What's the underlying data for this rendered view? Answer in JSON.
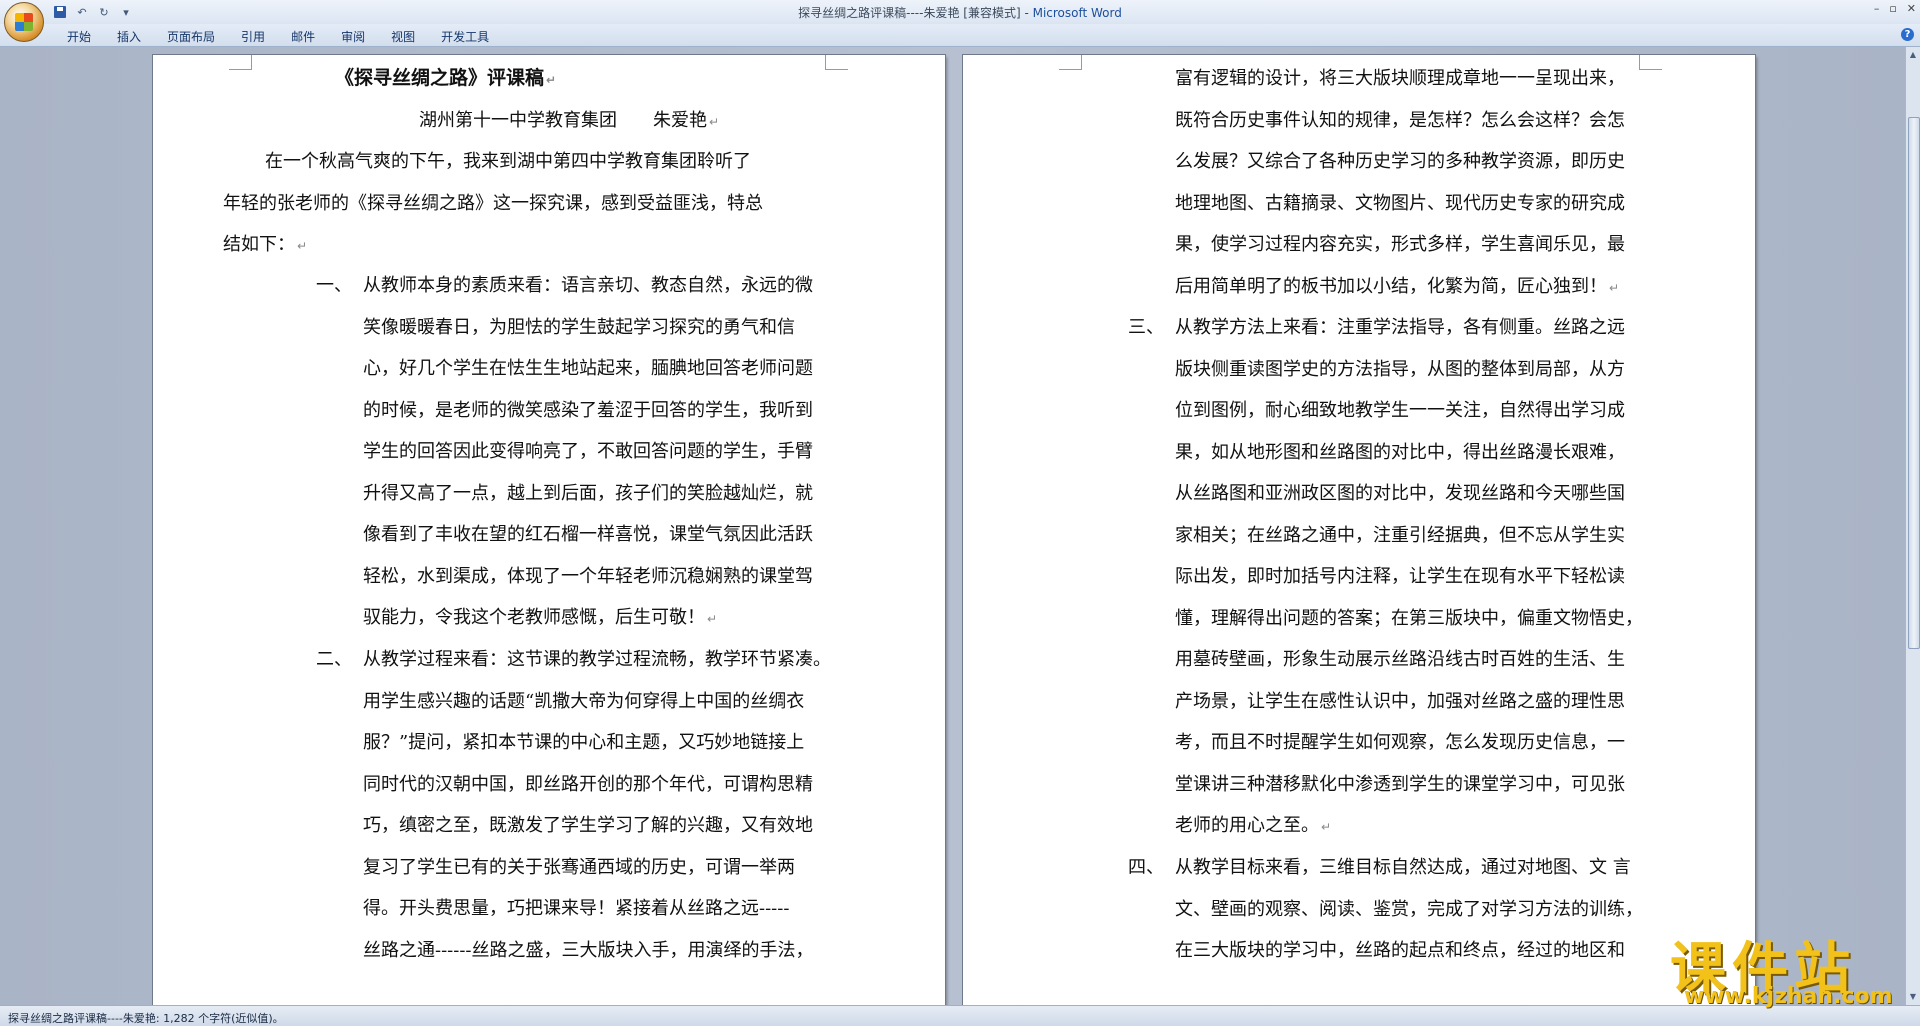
{
  "titlebar": {
    "doc_title": "探寻丝绸之路评课稿----朱爱艳 [兼容模式] - ",
    "app_name": "Microsoft Word"
  },
  "qat": {
    "save": "save-icon",
    "undo": "↶",
    "redo": "↻",
    "more": "▾"
  },
  "window_controls": {
    "minimize": "–",
    "restore": "▫",
    "close": "✕"
  },
  "ribbon": {
    "tabs": [
      "开始",
      "插入",
      "页面布局",
      "引用",
      "邮件",
      "审阅",
      "视图",
      "开发工具"
    ],
    "help": "?"
  },
  "left_page": {
    "title": "《探寻丝绸之路》评课稿",
    "author_line": "湖州第十一中学教育集团　　朱爱艳",
    "intro": [
      "在一个秋高气爽的下午，我来到湖中第四中学教育集团聆听了",
      "年轻的张老师的《探寻丝绸之路》这一探究课，感到受益匪浅，特总",
      "结如下："
    ],
    "item1_num": "一、",
    "item1": [
      "从教师本身的素质来看：语言亲切、教态自然，永远的微",
      "笑像暖暖春日，为胆怯的学生鼓起学习探究的勇气和信",
      "心，好几个学生在怯生生地站起来，腼腆地回答老师问题",
      "的时候，是老师的微笑感染了羞涩于回答的学生，我听到",
      "学生的回答因此变得响亮了，不敢回答问题的学生，手臂",
      "升得又高了一点，越上到后面，孩子们的笑脸越灿烂，就",
      "像看到了丰收在望的红石榴一样喜悦，课堂气氛因此活跃",
      "轻松，水到渠成，体现了一个年轻老师沉稳娴熟的课堂驾",
      "驭能力，令我这个老教师感慨，后生可敬！"
    ],
    "item2_num": "二、",
    "item2": [
      "从教学过程来看：这节课的教学过程流畅，教学环节紧凑。",
      "用学生感兴趣的话题“凯撒大帝为何穿得上中国的丝绸衣",
      "服？”提问，紧扣本节课的中心和主题，又巧妙地链接上",
      "同时代的汉朝中国，即丝路开创的那个年代，可谓构思精",
      "巧，缜密之至，既激发了学生学习了解的兴趣，又有效地",
      "复习了学生已有的关于张骞通西域的历史，可谓一举两",
      "得。开头费思量，巧把课来导！紧接着从丝路之远-----",
      "丝路之通------丝路之盛，三大版块入手，用演绎的手法，"
    ]
  },
  "right_page": {
    "cont": [
      "富有逻辑的设计，将三大版块顺理成章地一一呈现出来，",
      "既符合历史事件认知的规律，是怎样？怎么会这样？会怎",
      "么发展？又综合了各种历史学习的多种教学资源，即历史",
      "地理地图、古籍摘录、文物图片、现代历史专家的研究成",
      "果，使学习过程内容充实，形式多样，学生喜闻乐见，最",
      "后用简单明了的板书加以小结，化繁为简，匠心独到！"
    ],
    "item3_num": "三、",
    "item3": [
      "从教学方法上来看：注重学法指导，各有侧重。丝路之远",
      "版块侧重读图学史的方法指导，从图的整体到局部，从方",
      "位到图例，耐心细致地教学生一一关注，自然得出学习成",
      "果，如从地形图和丝路图的对比中，得出丝路漫长艰难，",
      "从丝路图和亚洲政区图的对比中，发现丝路和今天哪些国",
      "家相关；在丝路之通中，注重引经据典，但不忘从学生实",
      "际出发，即时加括号内注释，让学生在现有水平下轻松读",
      "懂，理解得出问题的答案；在第三版块中，偏重文物悟史，",
      "用墓砖壁画，形象生动展示丝路沿线古时百姓的生活、生",
      "产场景，让学生在感性认识中，加强对丝路之盛的理性思",
      "考，而且不时提醒学生如何观察，怎么发现历史信息，一",
      "堂课讲三种潜移默化中渗透到学生的课堂学习中，可见张",
      "老师的用心之至。"
    ],
    "item4_num": "四、",
    "item4": [
      "从教学目标来看，三维目标自然达成，通过对地图、文 言",
      "文、壁画的观察、阅读、鉴赏，完成了对学习方法的训练，",
      "在三大版块的学习中，丝路的起点和终点，经过的地区和"
    ]
  },
  "paragraph_mark": "↵",
  "statusbar": {
    "text": "探寻丝绸之路评课稿----朱爱艳: 1,282 个字符(近似值)。"
  },
  "watermark": {
    "cn": "课件站",
    "url": "www.kjzhan.com"
  },
  "scrollbar": {
    "up": "▲",
    "down": "▼"
  }
}
